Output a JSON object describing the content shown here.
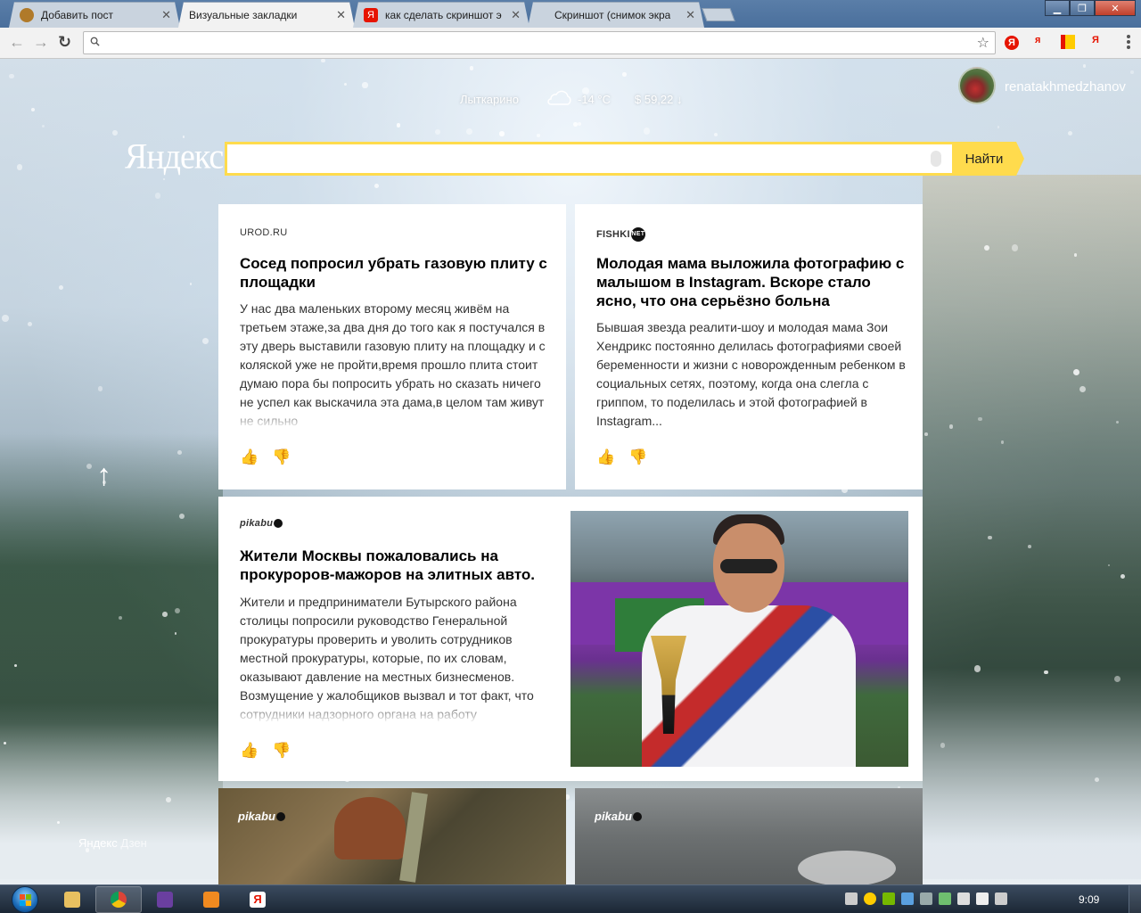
{
  "browser": {
    "tabs": [
      {
        "title": "Добавить пост",
        "icon": "pikabu-favicon",
        "color": "#b07a2a"
      },
      {
        "title": "Визуальные закладки",
        "icon": "none",
        "color": "",
        "active": true
      },
      {
        "title": "как сделать скриншот э",
        "icon": "yandex-favicon",
        "color": "#e61400"
      },
      {
        "title": "Скриншот (снимок экра",
        "icon": "none",
        "color": ""
      }
    ],
    "close_glyph": "✕",
    "address": {
      "value": "",
      "placeholder": ""
    },
    "back": "←",
    "forward": "→",
    "reload": "↻",
    "star": "☆",
    "extensions": [
      "Я",
      "я",
      "Я"
    ]
  },
  "page": {
    "city": "Лыткарино",
    "weather": "-14 °С",
    "currency": "$  59,22 ↓",
    "username": "renatakhmedzhanov",
    "logo": "Яндекс",
    "search_value": "",
    "search_button": "Найти",
    "up_arrow": "↑",
    "zen_label_main": "Яндекс",
    "zen_label_sub": "Дзен"
  },
  "feed": [
    {
      "source": "UROD.RU",
      "title": "Сосед попросил убрать газовую плиту с площадки",
      "text": "У нас два маленьких второму месяц живём на третьем этаже,за два дня до того как я постучался в эту дверь выставили газовую плиту на площадку и с коляской уже не пройти,время прошло плита стоит думаю пора бы попросить убрать но сказать ничего не успел как выскачила эта дама,в целом там живут не сильно"
    },
    {
      "source": "FISHKI",
      "source_badge": "NET",
      "title": "Молодая мама выложила фотографию с малышом в Instagram. Вскоре стало ясно, что она серьёзно больна",
      "text": "Бывшая звезда реалити-шоу и молодая мама Зои Хендрикс постоянно делилась фотографиями своей беременности и жизни с новорожденным ребенком в социальных сетях, поэтому, когда она слегла с гриппом, то поделилась и этой фотографией в Instagram..."
    },
    {
      "source": "pikabu",
      "title": "Жители Москвы пожаловались на прокуроров-мажоров на элитных авто.",
      "text": "Жители и предприниматели Бутырского района столицы попросили руководство Генеральной прокуратуры проверить и уволить сотрудников местной прокуратуры, которые, по их словам, оказывают давление на местных бизнесменов. Возмущение у жалобщиков вызвал и тот факт, что сотрудники надзорного органа на работу"
    },
    {
      "source": "pikabu"
    },
    {
      "source": "pikabu"
    }
  ],
  "reactions": {
    "like": "👍",
    "dislike": "👎"
  },
  "taskbar": {
    "apps": [
      "explorer",
      "chrome",
      "winamp",
      "media-player",
      "yandex-browser"
    ],
    "clock": "9:09"
  }
}
